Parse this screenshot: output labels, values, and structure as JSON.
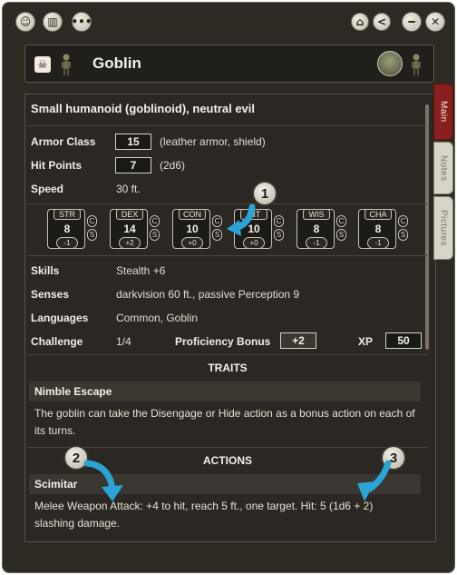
{
  "titlebar": {
    "left_icons": [
      "portrait-icon",
      "book-icon",
      "chat-icon"
    ],
    "right_icons": [
      "lock-icon",
      "share-icon",
      "minimize-icon",
      "close-icon"
    ]
  },
  "header": {
    "title": "Goblin"
  },
  "tabs": [
    {
      "label": "Main",
      "active": true
    },
    {
      "label": "Notes",
      "active": false
    },
    {
      "label": "Pictures",
      "active": false
    }
  ],
  "sheet": {
    "type_line": "Small humanoid (goblinoid), neutral evil",
    "armor_class": {
      "label": "Armor Class",
      "value": "15",
      "note": "(leather armor, shield)"
    },
    "hit_points": {
      "label": "Hit Points",
      "value": "7",
      "note": "(2d6)"
    },
    "speed": {
      "label": "Speed",
      "value": "30 ft."
    },
    "abilities": [
      {
        "name": "STR",
        "score": "8",
        "mod": "-1"
      },
      {
        "name": "DEX",
        "score": "14",
        "mod": "+2"
      },
      {
        "name": "CON",
        "score": "10",
        "mod": "+0"
      },
      {
        "name": "INT",
        "score": "10",
        "mod": "+0"
      },
      {
        "name": "WIS",
        "score": "8",
        "mod": "-1"
      },
      {
        "name": "CHA",
        "score": "8",
        "mod": "-1"
      }
    ],
    "ability_toggle_c": "C",
    "ability_toggle_s": "S",
    "skills": {
      "label": "Skills",
      "value": "Stealth +6"
    },
    "senses": {
      "label": "Senses",
      "value": "darkvision 60 ft., passive Perception 9"
    },
    "languages": {
      "label": "Languages",
      "value": "Common, Goblin"
    },
    "challenge": {
      "label": "Challenge",
      "value": "1/4"
    },
    "proficiency": {
      "label": "Proficiency Bonus",
      "value": "+2"
    },
    "xp": {
      "label": "XP",
      "value": "50"
    },
    "traits_heading": "TRAITS",
    "trait": {
      "name": "Nimble Escape",
      "text": "The goblin can take the Disengage or Hide action as a bonus action on each of its turns."
    },
    "actions_heading": "ACTIONS",
    "action": {
      "name": "Scimitar",
      "text": "Melee Weapon Attack: +4 to hit, reach 5 ft., one target. Hit: 5 (1d6 + 2) slashing damage."
    }
  },
  "callouts": [
    "1",
    "2",
    "3"
  ],
  "colors": {
    "background": "#2d2a24",
    "tab_active": "#8a1f1f",
    "arrow": "#2aa4d4"
  }
}
